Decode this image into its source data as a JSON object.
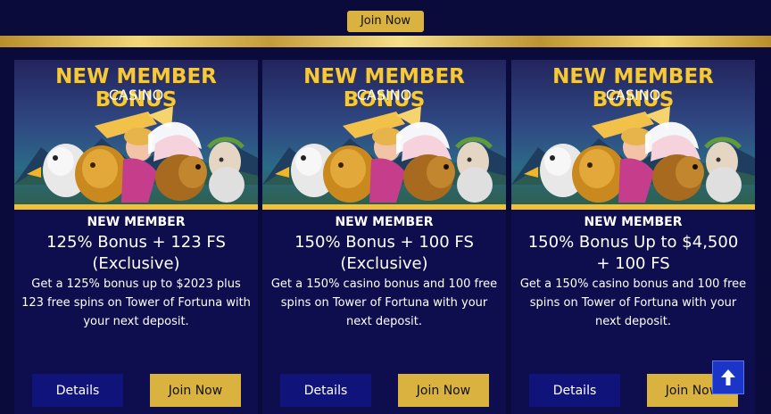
{
  "header": {
    "join_label": "Join Now"
  },
  "colors": {
    "background": "#0b0b3b",
    "card": "#0e0e4e",
    "gold": "#d9b23f",
    "details_button": "#10137a",
    "scroll_button": "#1c35c9"
  },
  "cards": [
    {
      "banner_title": "NEW MEMBER BONUS",
      "banner_subtitle": "CASINO",
      "eyebrow": "NEW MEMBER",
      "headline": "125% Bonus + 123 FS (Exclusive)",
      "description": "Get a 125% bonus up to $2023 plus 123 free spins on Tower of Fortuna with your next deposit.",
      "details_label": "Details",
      "join_label": "Join Now"
    },
    {
      "banner_title": "NEW MEMBER BONUS",
      "banner_subtitle": "CASINO",
      "eyebrow": "NEW MEMBER",
      "headline": "150% Bonus + 100 FS (Exclusive)",
      "description": "Get a 150% casino bonus and 100 free spins on Tower of Fortuna with your next deposit.",
      "details_label": "Details",
      "join_label": "Join Now"
    },
    {
      "banner_title": "NEW MEMBER BONUS",
      "banner_subtitle": "CASINO",
      "eyebrow": "NEW MEMBER",
      "headline": "150% Bonus Up to $4,500 + 100 FS",
      "description": "Get a 150% casino bonus and 100 free spins on Tower of Fortuna with your next deposit.",
      "details_label": "Details",
      "join_label": "Join Now"
    }
  ],
  "scroll_top": {
    "icon": "arrow-up-icon"
  }
}
